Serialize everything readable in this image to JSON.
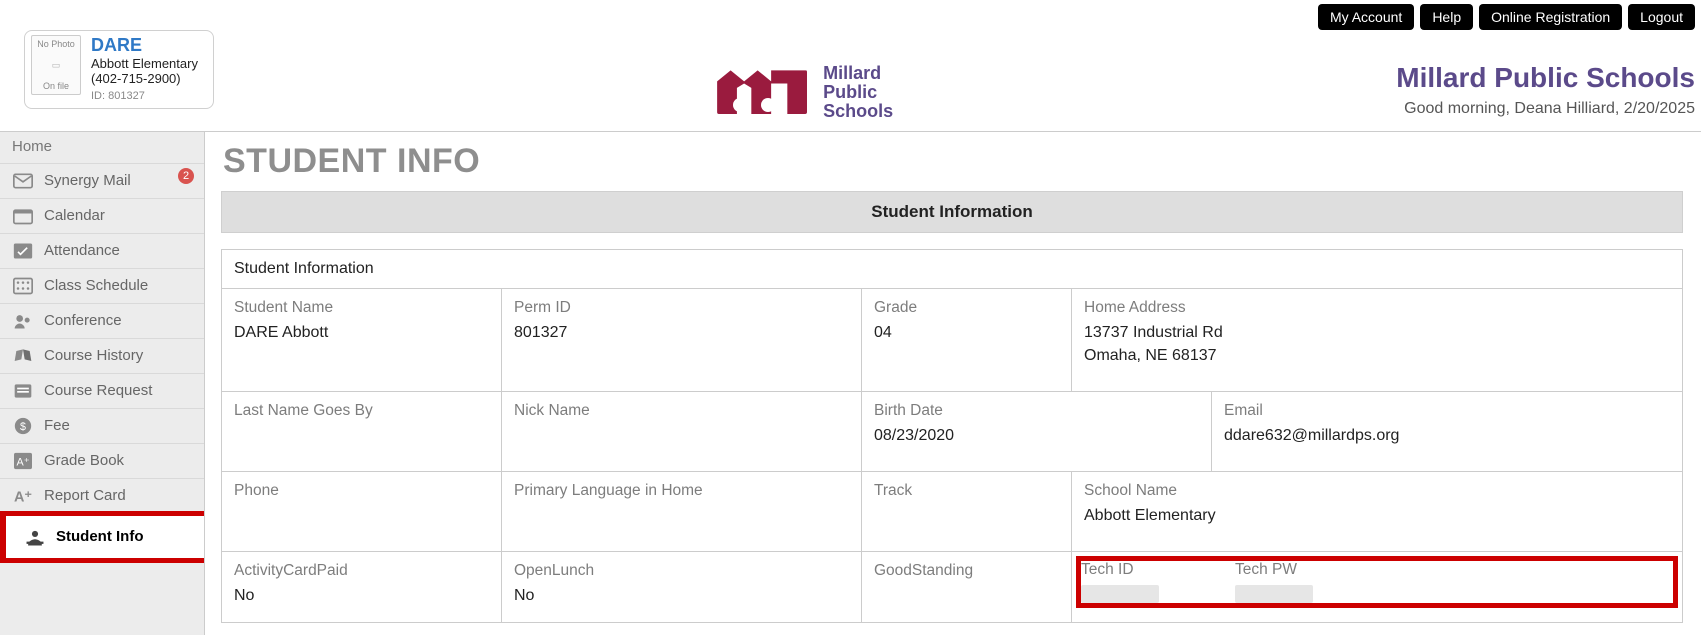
{
  "topnav": {
    "my_account": "My Account",
    "help": "Help",
    "online_registration": "Online Registration",
    "logout": "Logout"
  },
  "student_card": {
    "name": "DARE",
    "school": "Abbott Elementary",
    "phone": "(402-715-2900)",
    "id_label": "ID:",
    "id": "801327",
    "no_photo_top": "No Photo",
    "no_photo_bottom": "On file"
  },
  "logo_text_line1": "Millard",
  "logo_text_line2": "Public",
  "logo_text_line3": "Schools",
  "district": {
    "name": "Millard Public Schools",
    "greeting": "Good morning, Deana Hilliard, 2/20/2025"
  },
  "sidebar": {
    "home": "Home",
    "items": [
      {
        "label": "Synergy Mail",
        "icon": "mail-icon",
        "badge": "2"
      },
      {
        "label": "Calendar",
        "icon": "calendar-icon"
      },
      {
        "label": "Attendance",
        "icon": "attendance-icon"
      },
      {
        "label": "Class Schedule",
        "icon": "schedule-icon"
      },
      {
        "label": "Conference",
        "icon": "conference-icon"
      },
      {
        "label": "Course History",
        "icon": "books-icon"
      },
      {
        "label": "Course Request",
        "icon": "request-icon"
      },
      {
        "label": "Fee",
        "icon": "fee-icon"
      },
      {
        "label": "Grade Book",
        "icon": "gradebook-icon"
      },
      {
        "label": "Report Card",
        "icon": "reportcard-icon"
      },
      {
        "label": "Student Info",
        "icon": "studentinfo-icon",
        "active": true
      }
    ]
  },
  "page": {
    "title": "STUDENT INFO",
    "banner": "Student Information",
    "card_head": "Student Information",
    "fields": {
      "student_name": {
        "label": "Student Name",
        "value": "DARE Abbott"
      },
      "perm_id": {
        "label": "Perm ID",
        "value": "801327"
      },
      "grade": {
        "label": "Grade",
        "value": "04"
      },
      "home_address": {
        "label": "Home Address",
        "value_line1": "13737 Industrial Rd",
        "value_line2": "Omaha, NE 68137"
      },
      "last_name_goes_by": {
        "label": "Last Name Goes By",
        "value": ""
      },
      "nick_name": {
        "label": "Nick Name",
        "value": ""
      },
      "birth_date": {
        "label": "Birth Date",
        "value": "08/23/2020"
      },
      "email": {
        "label": "Email",
        "value": "ddare632@millardps.org"
      },
      "phone": {
        "label": "Phone",
        "value": ""
      },
      "primary_lang": {
        "label": "Primary Language in Home",
        "value": ""
      },
      "track": {
        "label": "Track",
        "value": ""
      },
      "school_name": {
        "label": "School Name",
        "value": "Abbott Elementary"
      },
      "activity_card": {
        "label": "ActivityCardPaid",
        "value": "No"
      },
      "open_lunch": {
        "label": "OpenLunch",
        "value": "No"
      },
      "good_standing": {
        "label": "GoodStanding",
        "value": ""
      },
      "tech_id": {
        "label": "Tech ID"
      },
      "tech_pw": {
        "label": "Tech PW"
      }
    }
  }
}
